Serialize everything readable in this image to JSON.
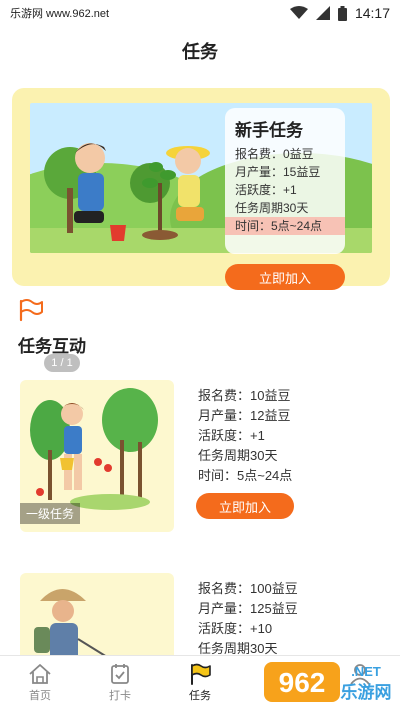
{
  "status_bar": {
    "site": "乐游网 www.962.net",
    "time": "14:17"
  },
  "header": {
    "title": "任务"
  },
  "banner": {
    "title": "新手任务",
    "lines": [
      "报名费：0益豆",
      "月产量：15益豆",
      "活跃度：+1",
      "任务周期30天"
    ],
    "time": "时间：5点~24点",
    "join_label": "立即加入",
    "pager": "1 / 1"
  },
  "section": {
    "title": "任务互动"
  },
  "tasks": [
    {
      "level": "一级任务",
      "lines": [
        "报名费：10益豆",
        "月产量：12益豆",
        "活跃度：+1",
        "任务周期30天",
        "时间：5点~24点"
      ],
      "join_label": "立即加入"
    },
    {
      "lines": [
        "报名费：100益豆",
        "月产量：125益豆",
        "活跃度：+10",
        "任务周期30天"
      ]
    }
  ],
  "nav": [
    {
      "label": "首页",
      "icon": "home-icon"
    },
    {
      "label": "打卡",
      "icon": "checkin-icon"
    },
    {
      "label": "任务",
      "icon": "flag-icon"
    },
    {
      "label": "",
      "icon": ""
    },
    {
      "label": "",
      "icon": ""
    }
  ],
  "watermark": {
    "text": "962",
    "sub": "乐游网",
    "suffix": ".NET"
  },
  "colors": {
    "accent": "#f46b1c",
    "banner_bg": "#fbf2b0",
    "card_bg": "#fdf8cf"
  }
}
